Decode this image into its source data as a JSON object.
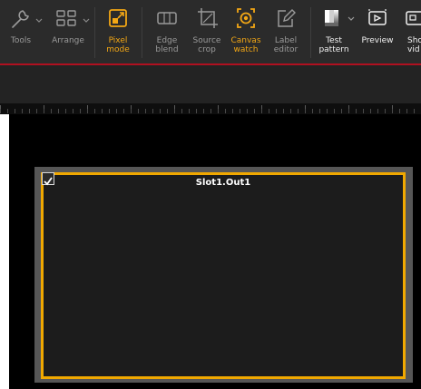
{
  "toolbar": {
    "tools": [
      {
        "label": "Tools",
        "icon": "wrench-icon",
        "state": "normal"
      },
      {
        "label": "Arrange",
        "icon": "grid-icon",
        "state": "normal"
      },
      {
        "label": "Pixel\nmode",
        "icon": "pixel-mode-icon",
        "state": "active"
      },
      {
        "label": "Edge\nblend",
        "icon": "edge-blend-icon",
        "state": "normal"
      },
      {
        "label": "Source\ncrop",
        "icon": "crop-icon",
        "state": "normal"
      },
      {
        "label": "Canvas\nwatch",
        "icon": "canvas-watch-icon",
        "state": "active"
      },
      {
        "label": "Label\neditor",
        "icon": "edit-icon",
        "state": "normal"
      },
      {
        "label": "Test\npattern",
        "icon": "test-pattern-icon",
        "state": "white"
      },
      {
        "label": "Preview",
        "icon": "preview-icon",
        "state": "white"
      },
      {
        "label": "Sho\nvid",
        "icon": "show-video-icon",
        "state": "white"
      }
    ],
    "accent_color": "#f3a715",
    "separator_color": "#b01020"
  },
  "canvas": {
    "slot": {
      "title": "Slot1.Out1",
      "checked": true,
      "border_color": "#f0a800"
    }
  }
}
